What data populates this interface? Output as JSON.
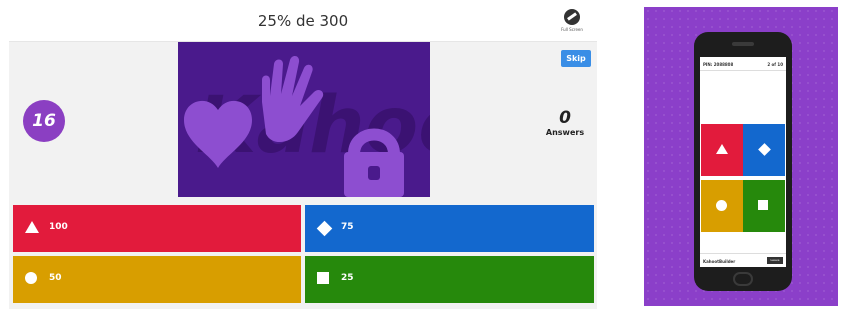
{
  "quiz": {
    "question": "25% de 300",
    "fullscreen_label": "Full Screen",
    "timer": "16",
    "skip_label": "Skip",
    "answers_count": "0",
    "answers_label": "Answers",
    "media_logo_text": "Kahoot!",
    "options": [
      {
        "shape": "triangle-icon",
        "color": "#e21b3c",
        "label": "100"
      },
      {
        "shape": "diamond-icon",
        "color": "#1368ce",
        "label": "75"
      },
      {
        "shape": "circle-icon",
        "color": "#d89e00",
        "label": "50"
      },
      {
        "shape": "square-icon",
        "color": "#26890c",
        "label": "25"
      }
    ]
  },
  "phone": {
    "pin": "PIN: 2088808",
    "progress": "2 of 10",
    "nickname": "KahootBuilder",
    "leave_label": "Leave"
  },
  "colors": {
    "brand_purple": "#8b3fc9",
    "red": "#e21b3c",
    "blue": "#1368ce",
    "yellow": "#d89e00",
    "green": "#26890c"
  }
}
